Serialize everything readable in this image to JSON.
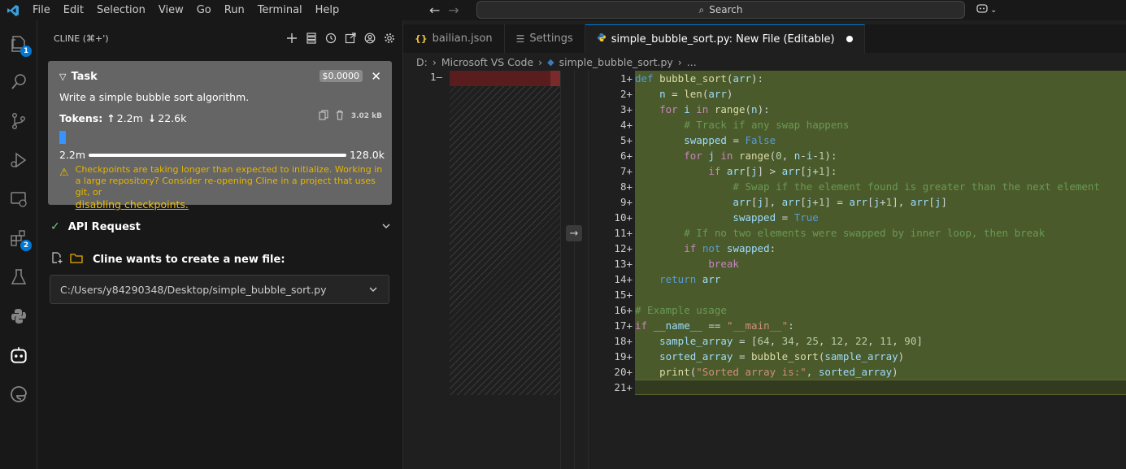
{
  "titlebar": {
    "menu": [
      "File",
      "Edit",
      "Selection",
      "View",
      "Go",
      "Run",
      "Terminal",
      "Help"
    ],
    "search_label": "Search"
  },
  "activitybar": {
    "explorer_badge": "1",
    "extensions_badge": "2"
  },
  "cline": {
    "header": "CLINE (⌘+')",
    "task": {
      "title": "Task",
      "cost": "$0.0000",
      "description": "Write a simple bubble sort algorithm.",
      "tokens_label": "Tokens:",
      "tokens_up": "2.2m",
      "tokens_down": "22.6k",
      "size": "3.02 kB",
      "context_used": "2.2m",
      "context_max": "128.0k",
      "warning": "Checkpoints are taking longer than expected to initialize. Working in a large repository? Consider re-opening Cline in a project that uses git, or",
      "warning_link": "disabling checkpoints."
    },
    "api_request": "API Request",
    "create_file_title": "Cline wants to create a new file:",
    "file_path": "C:/Users/y84290348/Desktop/simple_bubble_sort.py"
  },
  "tabs": [
    {
      "label": "bailian.json"
    },
    {
      "label": "Settings"
    },
    {
      "label": "simple_bubble_sort.py: New File (Editable)"
    }
  ],
  "breadcrumb": [
    "D:",
    "Microsoft VS Code",
    "simple_bubble_sort.py",
    "..."
  ],
  "diff": {
    "left_line": "1",
    "left_marker": "—",
    "right_lines": [
      {
        "n": "1",
        "text": "def bubble_sort(arr):"
      },
      {
        "n": "2",
        "text": "    n = len(arr)"
      },
      {
        "n": "3",
        "text": "    for i in range(n):"
      },
      {
        "n": "4",
        "text": "        # Track if any swap happens"
      },
      {
        "n": "5",
        "text": "        swapped = False"
      },
      {
        "n": "6",
        "text": "        for j in range(0, n-i-1):"
      },
      {
        "n": "7",
        "text": "            if arr[j] > arr[j+1]:"
      },
      {
        "n": "8",
        "text": "                # Swap if the element found is greater than the next element"
      },
      {
        "n": "9",
        "text": "                arr[j], arr[j+1] = arr[j+1], arr[j]"
      },
      {
        "n": "10",
        "text": "                swapped = True"
      },
      {
        "n": "11",
        "text": "        # If no two elements were swapped by inner loop, then break"
      },
      {
        "n": "12",
        "text": "        if not swapped:"
      },
      {
        "n": "13",
        "text": "            break"
      },
      {
        "n": "14",
        "text": "    return arr"
      },
      {
        "n": "15",
        "text": ""
      },
      {
        "n": "16",
        "text": "# Example usage"
      },
      {
        "n": "17",
        "text": "if __name__ == \"__main__\":"
      },
      {
        "n": "18",
        "text": "    sample_array = [64, 34, 25, 12, 22, 11, 90]"
      },
      {
        "n": "19",
        "text": "    sorted_array = bubble_sort(sample_array)"
      },
      {
        "n": "20",
        "text": "    print(\"Sorted array is:\", sorted_array)"
      },
      {
        "n": "21",
        "text": ""
      }
    ]
  },
  "colors": {
    "accent": "#0078d4",
    "added_bg": "#4b5a2a",
    "deleted_bg": "#5a1d1d",
    "task_card": "#656565",
    "warning": "#e5b500"
  }
}
